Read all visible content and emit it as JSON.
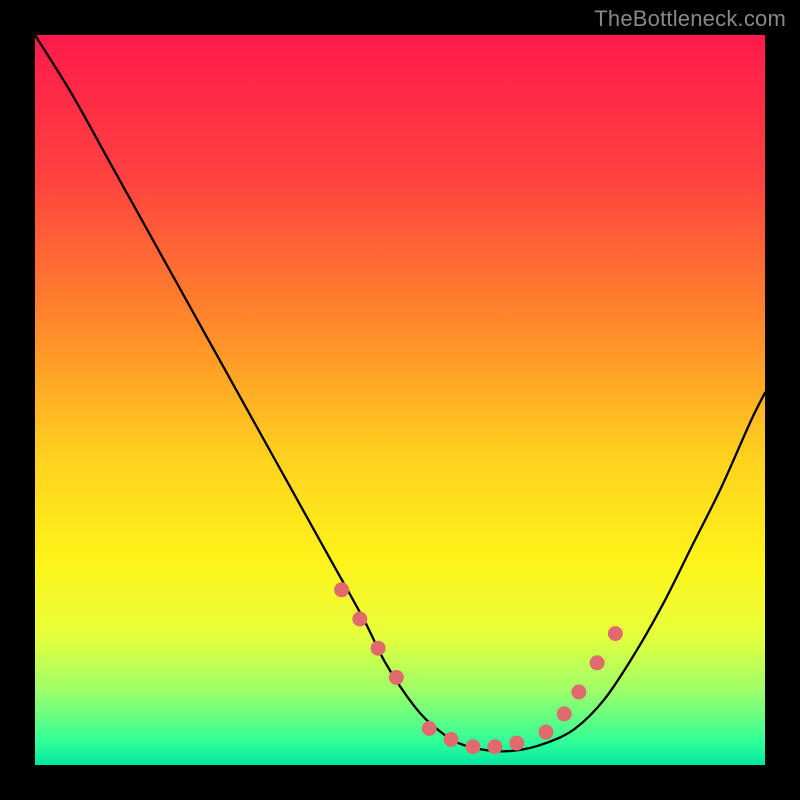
{
  "watermark": {
    "text": "TheBottleneck.com"
  },
  "chart_data": {
    "type": "line",
    "title": "",
    "xlabel": "",
    "ylabel": "",
    "xlim": [
      0,
      100
    ],
    "ylim": [
      0,
      100
    ],
    "grid": false,
    "legend": false,
    "gradient_stops": [
      {
        "offset": 0.0,
        "color": "#ff1a4b"
      },
      {
        "offset": 0.2,
        "color": "#ff4340"
      },
      {
        "offset": 0.4,
        "color": "#ff8a2a"
      },
      {
        "offset": 0.58,
        "color": "#ffd21f"
      },
      {
        "offset": 0.72,
        "color": "#fff31a"
      },
      {
        "offset": 0.82,
        "color": "#e7ff3a"
      },
      {
        "offset": 0.9,
        "color": "#9bff6a"
      },
      {
        "offset": 0.97,
        "color": "#2dff9a"
      },
      {
        "offset": 1.0,
        "color": "#00e6a0"
      }
    ],
    "series": [
      {
        "name": "bottleneck-curve",
        "x": [
          0,
          5,
          10,
          15,
          20,
          25,
          30,
          35,
          40,
          45,
          48,
          52,
          55,
          58,
          62,
          66,
          70,
          74,
          78,
          82,
          86,
          90,
          94,
          98,
          100
        ],
        "y": [
          100,
          92,
          83,
          74,
          65,
          56,
          47,
          38,
          29,
          20,
          14,
          8,
          5,
          3,
          2,
          2,
          3,
          5,
          9,
          15,
          22,
          30,
          38,
          47,
          51
        ]
      }
    ],
    "markers": {
      "name": "highlight-dots",
      "x": [
        42,
        44.5,
        47,
        49.5,
        54,
        57,
        60,
        63,
        66,
        70,
        72.5,
        74.5,
        77,
        79.5
      ],
      "y": [
        24,
        20,
        16,
        12,
        5,
        3.5,
        2.5,
        2.5,
        3,
        4.5,
        7,
        10,
        14,
        18
      ]
    }
  }
}
